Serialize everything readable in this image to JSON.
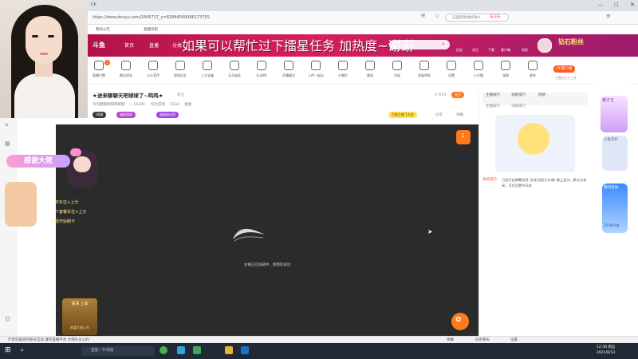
{
  "browser": {
    "tab_title": "Ch",
    "url": "https://www.douyu.com/2445737_y=8284456006617375S",
    "search_placeholder": "这国际歌谁抄歌H",
    "search_badge": "东方乐",
    "bookmarks": [
      "我的公告",
      "直播导航"
    ]
  },
  "douyu_header": {
    "logo": "斗鱼",
    "nav": [
      "首页",
      "直播",
      "分类"
    ],
    "marquee": "如果可以帮忙过下擂星任务 加热度~谢谢",
    "right_icons": [
      "历史",
      "关注",
      "下载",
      "客户端",
      "消息"
    ],
    "vip_badge": "钻石粉丝"
  },
  "icon_bar": {
    "items": [
      "直播付费",
      "舞台排名",
      "公众宣传",
      "提现历史",
      "上大宝箱",
      "天天抽奖",
      "行动PK",
      "开播模式",
      "上传一起玩",
      "小喇叭",
      "邀请",
      "问候",
      "家族特权",
      "设置",
      "小主播",
      "宠物",
      "更多"
    ],
    "badge": "3",
    "pc_button": "PC客户端",
    "pc_sub": "主播白天才上线"
  },
  "room": {
    "title": "★进来聊聊天吧球球了~鸣鸣★",
    "tag": "关注",
    "streamer": "泡泡糖鲸鲸鲸鲸鲸鲸",
    "hot": "15296",
    "meta_parts": [
      "综合游戏",
      "CSGO",
      "直播"
    ],
    "room_id": "47693",
    "follow_label": "关注",
    "level_pill": "V6周",
    "badge_pills": [
      "福星高照",
      "超级粉丝团"
    ],
    "rank_badge": "百强主播 1天前",
    "actions": [
      "分享",
      "举报"
    ]
  },
  "video": {
    "loading_text": "主播正在加载中，请稍后再试",
    "thanks_banner": "感谢大佬",
    "chat_lines": [
      "一天车位+上分",
      "一个套餐车位+上分",
      "已经开始刷卡"
    ],
    "gift_label": "清清 上车",
    "gift_sub": "恭喜大佬上车"
  },
  "right_panel": {
    "tabs": [
      "主播排行",
      "贡献排行",
      "周榜"
    ],
    "rank_tabs": [
      "主播排行",
      "贡献排行"
    ],
    "notice_label": "系统提示:",
    "notice_text": "已经开启弹幕消息 (历史消息已存储) 最上显示，默认为关闭，可在设置中开启"
  },
  "ad_column": {
    "labels": [
      "帽子王",
      "斗鱼守护",
      "限时活动"
    ],
    "price": "15:00开抢"
  },
  "status_bar": {
    "left": "严禁在规则内聊天互动 遵守直播平台 文明礼仪公约",
    "right": [
      "弹幕",
      "同步聊天",
      "设置"
    ]
  },
  "taskbar": {
    "search": "百度一下/问答",
    "time": "12:30 周五",
    "date": "2021/8/13"
  }
}
